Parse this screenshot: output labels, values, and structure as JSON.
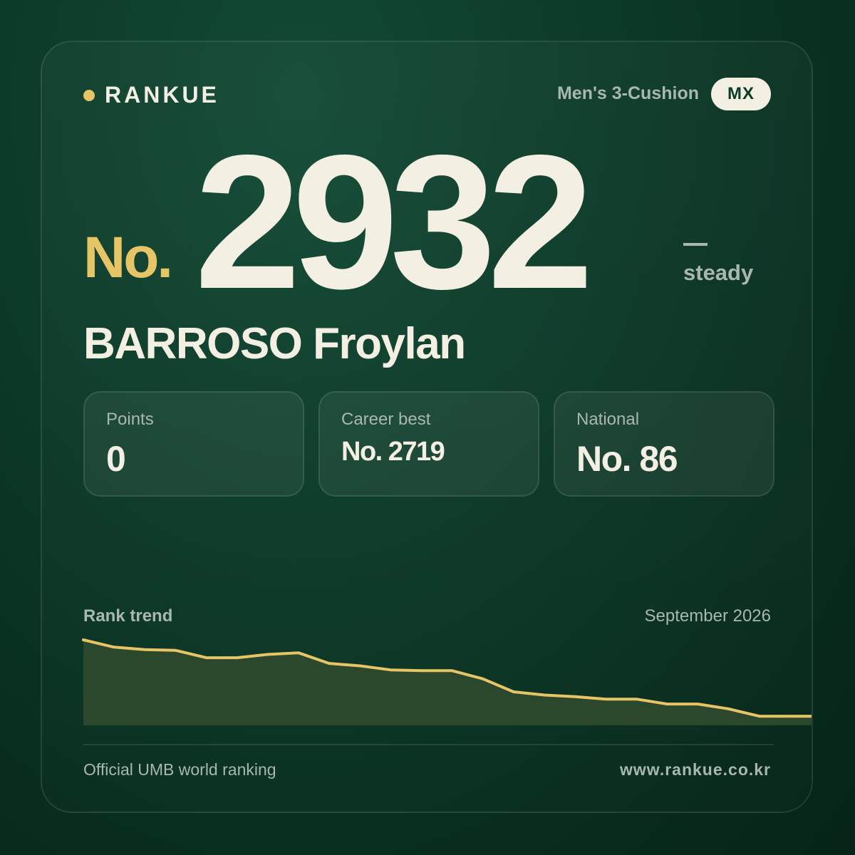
{
  "brand": {
    "name": "RANKUE"
  },
  "category": "Men's 3-Cushion",
  "country_code": "MX",
  "rank": {
    "prefix": "No.",
    "number": "2932",
    "change_symbol": "—",
    "change_label": "steady"
  },
  "player": {
    "name": "BARROSO Froylan"
  },
  "stats": [
    {
      "label": "Points",
      "value": "0"
    },
    {
      "label": "Career best",
      "value": "No. 2719"
    },
    {
      "label": "National",
      "value": "No. 86"
    }
  ],
  "trend": {
    "label": "Rank trend",
    "date": "September 2026"
  },
  "chart_data": {
    "type": "area",
    "title": "",
    "xlabel": "",
    "ylabel": "",
    "grid": false,
    "x": [
      1,
      2,
      3,
      4,
      5,
      6,
      7,
      8,
      9,
      10,
      11,
      12,
      13,
      14,
      15,
      16,
      17,
      18,
      19,
      20,
      21,
      22,
      23,
      24,
      25
    ],
    "values": [
      100,
      91,
      88,
      87,
      78,
      78,
      82,
      84,
      71,
      68,
      63,
      62,
      62,
      52,
      36,
      32,
      30,
      27,
      27,
      21,
      21,
      15,
      6,
      6,
      6
    ],
    "line_color": "#e7c466",
    "fill_color": "#2b472c"
  },
  "footer": {
    "source": "Official UMB world ranking",
    "url": "www.rankue.co.kr"
  }
}
